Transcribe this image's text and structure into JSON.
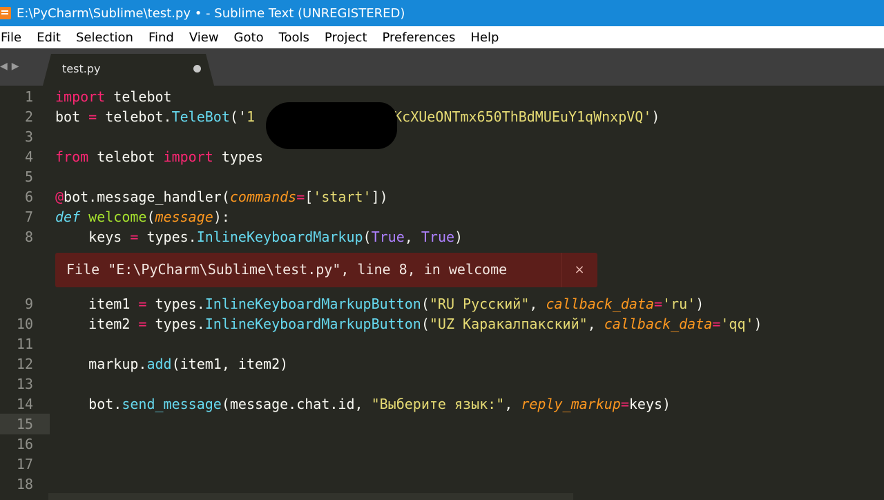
{
  "window": {
    "title": "E:\\PyCharm\\Sublime\\test.py • - Sublime Text (UNREGISTERED)"
  },
  "menu": [
    "File",
    "Edit",
    "Selection",
    "Find",
    "View",
    "Goto",
    "Tools",
    "Project",
    "Preferences",
    "Help"
  ],
  "tab": {
    "label": "test.py"
  },
  "gutter": [
    "1",
    "2",
    "3",
    "4",
    "5",
    "6",
    "7",
    "8",
    "9",
    "10",
    "11",
    "12",
    "13",
    "14",
    "15",
    "16",
    "17",
    "18"
  ],
  "code": {
    "l1": {
      "kw": "import",
      "rest": " telebot"
    },
    "l2": {
      "a": "bot ",
      "op": "=",
      "b": " telebot.",
      "cls": "TeleBot",
      "c": "('",
      "pre_redact": "1",
      "str": "AVKcXUeONTmx650ThBdMUEuY1qWnxpVQ'",
      "end": ")"
    },
    "l4": {
      "kw1": "from",
      "mid": " telebot ",
      "kw2": "import",
      "rest": " types"
    },
    "l6": {
      "at": "@",
      "a": "bot.message_handler(",
      "param": "commands",
      "op": "=",
      "b": "[",
      "str": "'start'",
      "c": "])"
    },
    "l7": {
      "def": "def",
      "sp": " ",
      "fn": "welcome",
      "a": "(",
      "param": "message",
      "b": "):"
    },
    "l8": {
      "a": "    keys ",
      "op": "=",
      "b": " types.",
      "fn": "InlineKeyboardMarkup",
      "c": "(",
      "c1": "True",
      "d": ", ",
      "c2": "True",
      "e": ")"
    },
    "l9": {
      "a": "    item1 ",
      "op": "=",
      "b": " types.",
      "fn": "InlineKeyboardMarkupButton",
      "c": "(",
      "str": "\"RU Русский\"",
      "d": ", ",
      "param": "callback_data",
      "op2": "=",
      "str2": "'ru'",
      "e": ")"
    },
    "l10": {
      "a": "    item2 ",
      "op": "=",
      "b": " types.",
      "fn": "InlineKeyboardMarkupButton",
      "c": "(",
      "str": "\"UZ Каракалпакский\"",
      "d": ", ",
      "param": "callback_data",
      "op2": "=",
      "str2": "'qq'",
      "e": ")"
    },
    "l12": {
      "a": "    markup.",
      "fn": "add",
      "b": "(item1, item2)"
    },
    "l14": {
      "a": "    bot.",
      "fn": "send_message",
      "b": "(message.chat.id, ",
      "str": "\"Выберите язык:\"",
      "c": ", ",
      "param": "reply_markup",
      "op": "=",
      "d": "keys)"
    }
  },
  "error": {
    "text": "File \"E:\\PyCharm\\Sublime\\test.py\", line 8, in welcome",
    "close": "×"
  },
  "colors": {
    "titlebar": "#1788d8",
    "editor_bg": "#272822",
    "error_bg": "#5c1e1a",
    "keyword": "#f92672",
    "function": "#a6e22e",
    "string": "#e6db74",
    "param": "#fd971f"
  }
}
